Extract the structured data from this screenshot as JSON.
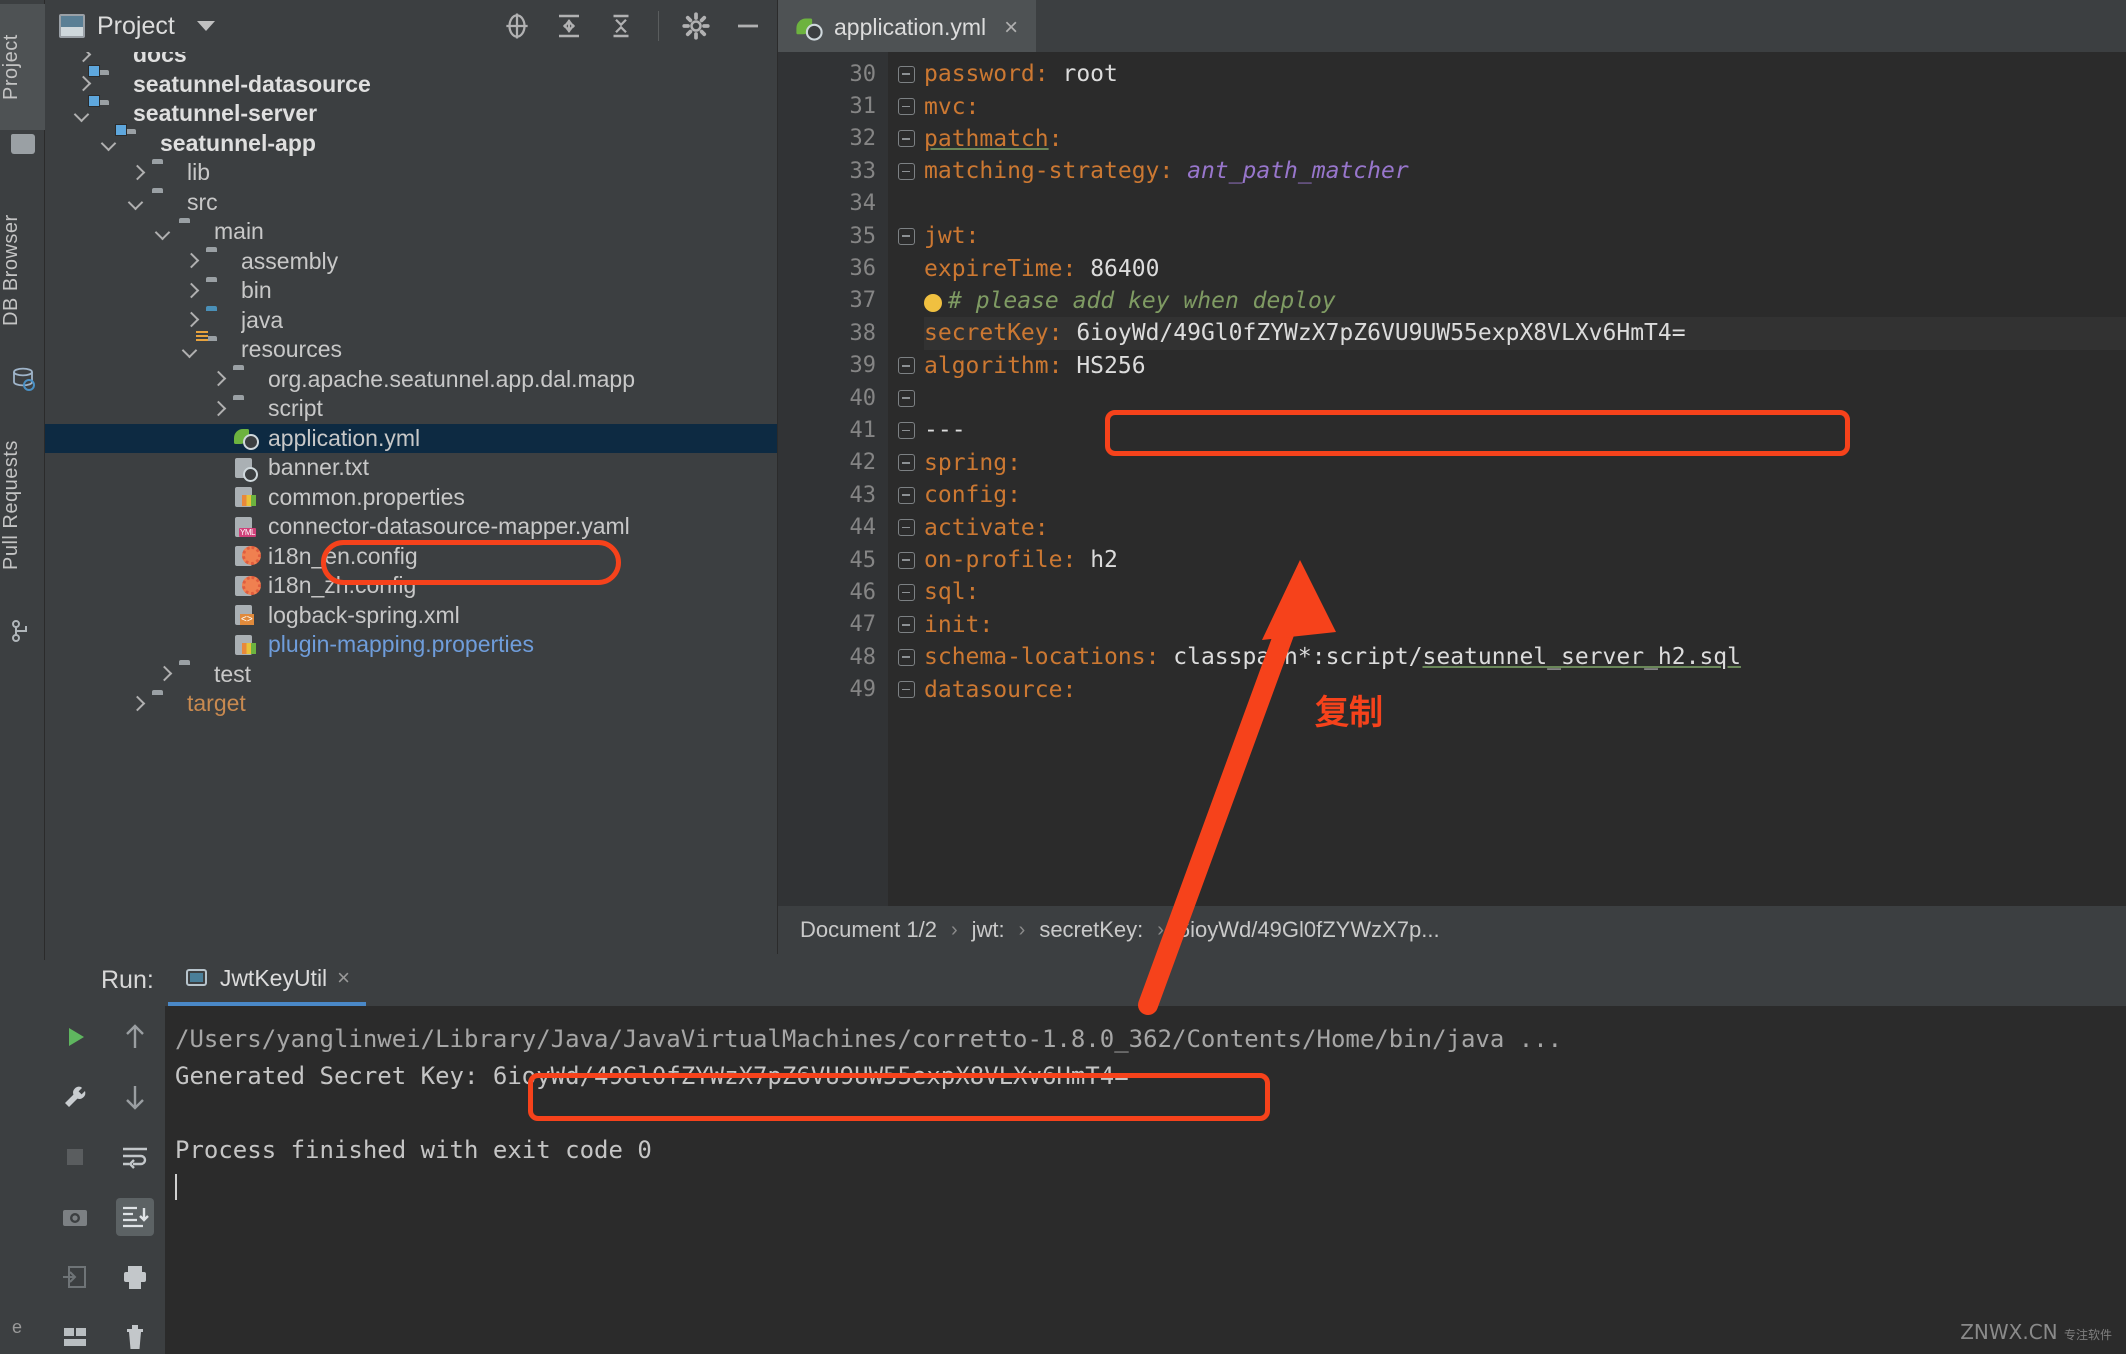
{
  "left_strip": {
    "tabs": [
      {
        "label": "Project",
        "icon": "project-icon",
        "active": true
      },
      {
        "label": "DB Browser",
        "icon": "database-icon",
        "active": false
      },
      {
        "label": "Pull Requests",
        "icon": "pull-request-icon",
        "active": false
      }
    ]
  },
  "project_panel": {
    "title": "Project",
    "toolbar_icons": [
      "locate-icon",
      "expand-all-icon",
      "collapse-all-icon",
      "gear-icon",
      "minimize-icon"
    ],
    "tree": [
      {
        "label": "docs",
        "depth": 1,
        "arrow": "right",
        "icon": "folder",
        "style": "bold",
        "clipped": true
      },
      {
        "label": "seatunnel-datasource",
        "depth": 1,
        "arrow": "right",
        "icon": "folder-module",
        "style": "bold"
      },
      {
        "label": "seatunnel-server",
        "depth": 1,
        "arrow": "down",
        "icon": "folder-module",
        "style": "bold"
      },
      {
        "label": "seatunnel-app",
        "depth": 2,
        "arrow": "down",
        "icon": "folder-module",
        "style": "bold"
      },
      {
        "label": "lib",
        "depth": 3,
        "arrow": "right",
        "icon": "folder",
        "style": "normal"
      },
      {
        "label": "src",
        "depth": 3,
        "arrow": "down",
        "icon": "folder",
        "style": "normal"
      },
      {
        "label": "main",
        "depth": 4,
        "arrow": "down",
        "icon": "folder",
        "style": "normal"
      },
      {
        "label": "assembly",
        "depth": 5,
        "arrow": "right",
        "icon": "folder",
        "style": "normal"
      },
      {
        "label": "bin",
        "depth": 5,
        "arrow": "right",
        "icon": "folder",
        "style": "normal"
      },
      {
        "label": "java",
        "depth": 5,
        "arrow": "right",
        "icon": "folder-sources",
        "style": "normal"
      },
      {
        "label": "resources",
        "depth": 5,
        "arrow": "down",
        "icon": "folder-resources",
        "style": "normal"
      },
      {
        "label": "org.apache.seatunnel.app.dal.mapp",
        "depth": 6,
        "arrow": "right",
        "icon": "folder",
        "style": "normal"
      },
      {
        "label": "script",
        "depth": 6,
        "arrow": "right",
        "icon": "folder",
        "style": "normal"
      },
      {
        "label": "application.yml",
        "depth": 6,
        "arrow": "none",
        "icon": "spring-yaml",
        "style": "selected"
      },
      {
        "label": "banner.txt",
        "depth": 6,
        "arrow": "none",
        "icon": "text-file",
        "style": "normal"
      },
      {
        "label": "common.properties",
        "depth": 6,
        "arrow": "none",
        "icon": "properties-file",
        "style": "normal"
      },
      {
        "label": "connector-datasource-mapper.yaml",
        "depth": 6,
        "arrow": "none",
        "icon": "yaml-file",
        "style": "normal"
      },
      {
        "label": "i18n_en.config",
        "depth": 6,
        "arrow": "none",
        "icon": "config-file",
        "style": "normal"
      },
      {
        "label": "i18n_zh.config",
        "depth": 6,
        "arrow": "none",
        "icon": "config-file",
        "style": "normal"
      },
      {
        "label": "logback-spring.xml",
        "depth": 6,
        "arrow": "none",
        "icon": "xml-file",
        "style": "normal"
      },
      {
        "label": "plugin-mapping.properties",
        "depth": 6,
        "arrow": "none",
        "icon": "properties-file",
        "style": "blue"
      },
      {
        "label": "test",
        "depth": 4,
        "arrow": "right",
        "icon": "folder",
        "style": "normal"
      },
      {
        "label": "target",
        "depth": 3,
        "arrow": "right",
        "icon": "folder-target",
        "style": "orange"
      }
    ]
  },
  "editor": {
    "tab": {
      "label": "application.yml",
      "icon": "spring-yaml",
      "close": "×"
    },
    "lines": [
      {
        "num": "30",
        "fold": true,
        "indent": 4,
        "segments": [
          {
            "t": "password",
            "c": "k"
          },
          {
            "t": ": ",
            "c": "k"
          },
          {
            "t": "root",
            "c": "v"
          }
        ]
      },
      {
        "num": "31",
        "fold": true,
        "indent": 2,
        "segments": [
          {
            "t": "mvc",
            "c": "k"
          },
          {
            "t": ":",
            "c": "k"
          }
        ]
      },
      {
        "num": "32",
        "fold": true,
        "indent": 3,
        "segments": [
          {
            "t": "pathmatch",
            "c": "k ul"
          },
          {
            "t": ":",
            "c": "k"
          }
        ]
      },
      {
        "num": "33",
        "fold": true,
        "indent": 4,
        "segments": [
          {
            "t": "matching-strategy",
            "c": "k"
          },
          {
            "t": ": ",
            "c": "k"
          },
          {
            "t": "ant_path_matcher",
            "c": "vi"
          }
        ]
      },
      {
        "num": "34",
        "fold": false,
        "indent": 0,
        "segments": []
      },
      {
        "num": "35",
        "fold": true,
        "indent": 0,
        "segments": [
          {
            "t": "jwt",
            "c": "k"
          },
          {
            "t": ":",
            "c": "k"
          }
        ]
      },
      {
        "num": "36",
        "fold": false,
        "indent": 2,
        "segments": [
          {
            "t": "expireTime",
            "c": "k"
          },
          {
            "t": ": ",
            "c": "k"
          },
          {
            "t": "86400",
            "c": "v"
          }
        ]
      },
      {
        "num": "37",
        "fold": false,
        "indent": 2,
        "bulb": true,
        "segments": [
          {
            "t": "# please add key when deploy",
            "c": "cm"
          }
        ]
      },
      {
        "num": "38",
        "fold": false,
        "indent": 2,
        "current": true,
        "segments": [
          {
            "t": "secretKey",
            "c": "k"
          },
          {
            "t": ": ",
            "c": "k"
          },
          {
            "t": "6ioyWd/49Gl0fZYWzX7pZ6VU9UW55expX8VLXv6HmT4=",
            "c": "v"
          }
        ]
      },
      {
        "num": "39",
        "fold": true,
        "indent": 2,
        "segments": [
          {
            "t": "algorithm",
            "c": "k"
          },
          {
            "t": ": ",
            "c": "k"
          },
          {
            "t": "HS256",
            "c": "v"
          }
        ]
      },
      {
        "num": "40",
        "fold": true,
        "indent": 0,
        "segments": []
      },
      {
        "num": "41",
        "fold": true,
        "indent": 0,
        "segments": [
          {
            "t": "---",
            "c": "v"
          }
        ]
      },
      {
        "num": "42",
        "fold": true,
        "indent": 0,
        "segments": [
          {
            "t": "spring",
            "c": "k"
          },
          {
            "t": ":",
            "c": "k"
          }
        ]
      },
      {
        "num": "43",
        "fold": true,
        "indent": 1,
        "segments": [
          {
            "t": "config",
            "c": "k"
          },
          {
            "t": ":",
            "c": "k"
          }
        ]
      },
      {
        "num": "44",
        "fold": true,
        "indent": 2,
        "segments": [
          {
            "t": "activate",
            "c": "k"
          },
          {
            "t": ":",
            "c": "k"
          }
        ]
      },
      {
        "num": "45",
        "fold": true,
        "indent": 3,
        "segments": [
          {
            "t": "on-profile",
            "c": "k"
          },
          {
            "t": ": ",
            "c": "k"
          },
          {
            "t": "h2",
            "c": "v"
          }
        ]
      },
      {
        "num": "46",
        "fold": true,
        "indent": 1,
        "segments": [
          {
            "t": "sql",
            "c": "k"
          },
          {
            "t": ":",
            "c": "k"
          }
        ]
      },
      {
        "num": "47",
        "fold": true,
        "indent": 2,
        "segments": [
          {
            "t": "init",
            "c": "k"
          },
          {
            "t": ":",
            "c": "k"
          }
        ]
      },
      {
        "num": "48",
        "fold": true,
        "indent": 3,
        "segments": [
          {
            "t": "schema-locations",
            "c": "k"
          },
          {
            "t": ": ",
            "c": "k"
          },
          {
            "t": "classpath*:script/",
            "c": "v"
          },
          {
            "t": "seatunnel_server_h2.sql",
            "c": "v ul"
          }
        ]
      },
      {
        "num": "49",
        "fold": true,
        "indent": 1,
        "segments": [
          {
            "t": "datasource",
            "c": "k"
          },
          {
            "t": ":",
            "c": "k"
          }
        ]
      }
    ],
    "breadcrumb": [
      "Document 1/2",
      "jwt:",
      "secretKey:",
      "6ioyWd/49Gl0fZYWzX7p..."
    ]
  },
  "run_panel": {
    "label": "Run:",
    "tab_label": "JwtKeyUtil",
    "tab_close": "×",
    "left_buttons": [
      "run-icon",
      "wrench-icon",
      "stop-icon",
      "camera-icon",
      "export-icon",
      "layout-icon"
    ],
    "right_buttons": [
      "up-arrow-icon",
      "down-arrow-icon",
      "soft-wrap-icon",
      "scroll-to-end-icon",
      "print-icon",
      "trash-icon"
    ],
    "console_lines": [
      "/Users/yanglinwei/Library/Java/JavaVirtualMachines/corretto-1.8.0_362/Contents/Home/bin/java ...",
      "Generated Secret Key: 6ioyWd/49Gl0fZYWzX7pZ6VU9UW55expX8VLXv6HmT4=",
      "",
      "Process finished with exit code 0"
    ],
    "console_prefix_generated": "Generated Secret Key: ",
    "console_key": "6ioyWd/49Gl0fZYWzX7pZ6VU9UW55expX8VLXv6HmT4="
  },
  "annotations": {
    "copy_note": "复制",
    "highlight_color": "#f6421b"
  },
  "watermark": {
    "text": "ZNWX.CN",
    "sub": "专注软件"
  }
}
